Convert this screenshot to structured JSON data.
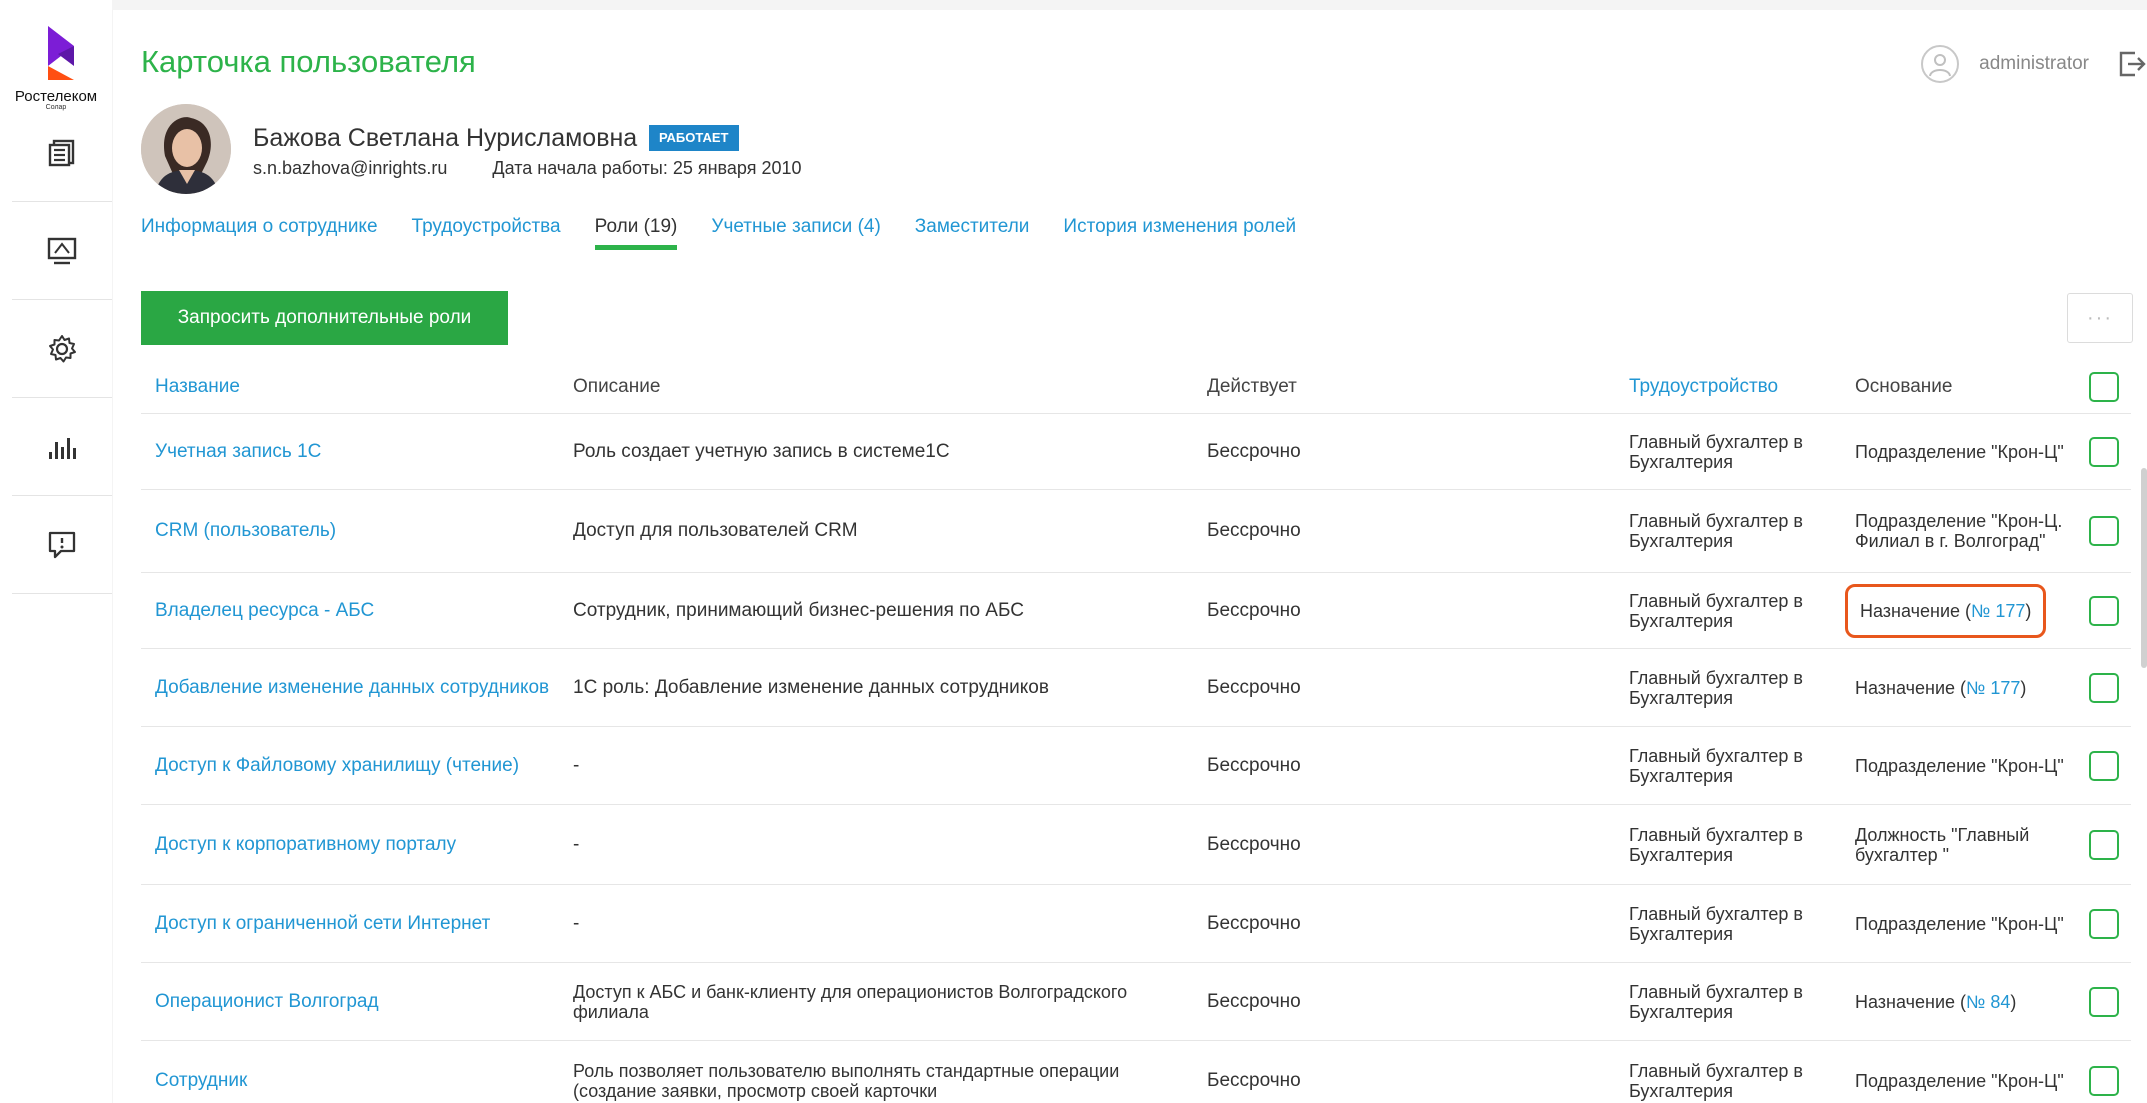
{
  "brand": {
    "name": "Ростелеком",
    "sub": "Солар",
    "accent": "#7c1dd6",
    "accent2": "#ff4f12"
  },
  "sidebar": {
    "items": [
      {
        "icon": "documents-icon"
      },
      {
        "icon": "monitor-icon"
      },
      {
        "icon": "gear-icon"
      },
      {
        "icon": "bar-chart-icon"
      },
      {
        "icon": "feedback-icon"
      }
    ]
  },
  "header": {
    "title": "Карточка пользователя",
    "username": "administrator"
  },
  "employee": {
    "name": "Бажова Светлана Нурисламовна",
    "status": "РАБОТАЕТ",
    "email": "s.n.bazhova@inrights.ru",
    "start_date": "Дата начала работы: 25 января 2010"
  },
  "tabs": [
    {
      "label": "Информация о сотруднике",
      "active": false
    },
    {
      "label": "Трудоустройства",
      "active": false
    },
    {
      "label": "Роли (19)",
      "active": true
    },
    {
      "label": "Учетные записи (4)",
      "active": false
    },
    {
      "label": "Заместители",
      "active": false
    },
    {
      "label": "История изменения ролей",
      "active": false
    }
  ],
  "actions": {
    "request_label": "Запросить дополнительные роли",
    "more_label": "···"
  },
  "table": {
    "headers": {
      "name": "Название",
      "description": "Описание",
      "validity": "Действует",
      "employment": "Трудоустройство",
      "basis": "Основание"
    },
    "rows": [
      {
        "name": "Учетная запись 1С",
        "description": "Роль создает учетную запись в системе1С",
        "validity": "Бессрочно",
        "employment": "Главный бухгалтер в Бухгалтерия",
        "basis": "Подразделение \"Крон-Ц\"",
        "basis_link": ""
      },
      {
        "name": "CRM (пользователь)",
        "description": "Доступ для пользователей CRM",
        "validity": "Бессрочно",
        "employment": "Главный бухгалтер в Бухгалтерия",
        "basis": "Подразделение \"Крон-Ц. Филиал в г. Волгоград\"",
        "basis_link": ""
      },
      {
        "name": "Владелец ресурса - АБС",
        "description": "Сотрудник, принимающий бизнес-решения по АБС",
        "validity": "Бессрочно",
        "employment": "Главный бухгалтер в Бухгалтерия",
        "basis": "Назначение (",
        "basis_link": "№ 177",
        "basis_end": ")"
      },
      {
        "name": "Добавление изменение данных сотрудников",
        "description": "1С роль: Добавление изменение данных сотрудников",
        "validity": "Бессрочно",
        "employment": "Главный бухгалтер в Бухгалтерия",
        "basis": "Назначение (",
        "basis_link": "№ 177",
        "basis_end": ")"
      },
      {
        "name": "Доступ к Файловому хранилищу (чтение)",
        "description": "-",
        "validity": "Бессрочно",
        "employment": "Главный бухгалтер в Бухгалтерия",
        "basis": "Подразделение \"Крон-Ц\"",
        "basis_link": ""
      },
      {
        "name": "Доступ к корпоративному порталу",
        "description": "-",
        "validity": "Бессрочно",
        "employment": "Главный бухгалтер в Бухгалтерия",
        "basis": "Должность \"Главный бухгалтер \"",
        "basis_link": ""
      },
      {
        "name": "Доступ к ограниченной сети Интернет",
        "description": "-",
        "validity": "Бессрочно",
        "employment": "Главный бухгалтер в Бухгалтерия",
        "basis": "Подразделение \"Крон-Ц\"",
        "basis_link": ""
      },
      {
        "name": "Операционист Волгоград",
        "description": "Доступ к АБС и банк-клиенту для операционистов Волгоградского филиала",
        "validity": "Бессрочно",
        "employment": "Главный бухгалтер в Бухгалтерия",
        "basis": "Назначение (",
        "basis_link": "№ 84",
        "basis_end": ")"
      },
      {
        "name": "Сотрудник",
        "description": "Роль позволяет пользователю выполнять стандартные операции (создание заявки, просмотр своей карточки",
        "validity": "Бессрочно",
        "employment": "Главный бухгалтер в Бухгалтерия",
        "basis": "Подразделение \"Крон-Ц\"",
        "basis_link": ""
      }
    ]
  }
}
